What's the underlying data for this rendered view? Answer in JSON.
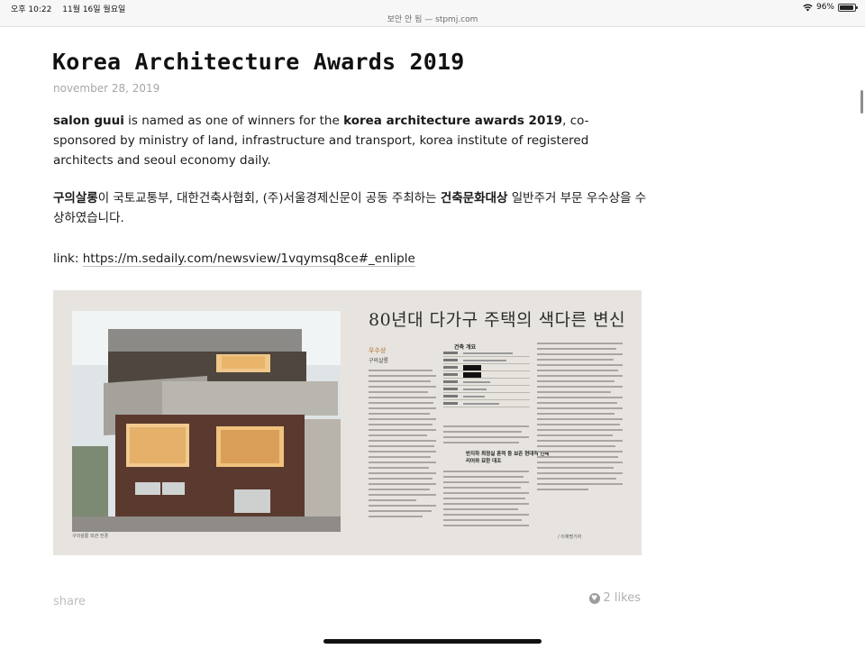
{
  "status_bar": {
    "time": "오후 10:22",
    "date": "11월 16일 월요일",
    "url": "보안 안 됨 — stpmj.com",
    "battery_percent": "96%",
    "battery_level": 0.96
  },
  "post": {
    "title": "Korea Architecture Awards 2019",
    "date": "november 28, 2019",
    "p1": {
      "b1": "salon guui",
      "t1": " is named as one of winners for the ",
      "b2": "korea architecture awards 2019",
      "t2": ", co-sponsored by ministry of land, infrastructure and transport, korea institute of registered architects and seoul economy daily."
    },
    "p2": {
      "b1": "구의살롱",
      "t1": "이 국토교통부, 대한건축사협회, (주)서울경제신문이 공동 주최하는 ",
      "b2": "건축문화대상",
      "t2": " 일반주거 부문 우수상을 수상하였습니다."
    },
    "link_label": "link: ",
    "link_text": "https://m.sedaily.com/newsview/1vqymsq8ce#_enliple"
  },
  "clipping": {
    "headline": "80년대 다가구 주택의 색다른 변신",
    "section": "우수상",
    "subsection": "구의살롱",
    "box_title": "건축 개요",
    "boxed_heading": "반지하 최정실 흔적 등 보존 현대적 인테리어와 묘한 대조"
  },
  "footer": {
    "share": "share",
    "likes": "2 likes"
  },
  "icons": {
    "wifi": "wifi-icon",
    "battery": "battery-icon",
    "heart": "heart-icon"
  }
}
